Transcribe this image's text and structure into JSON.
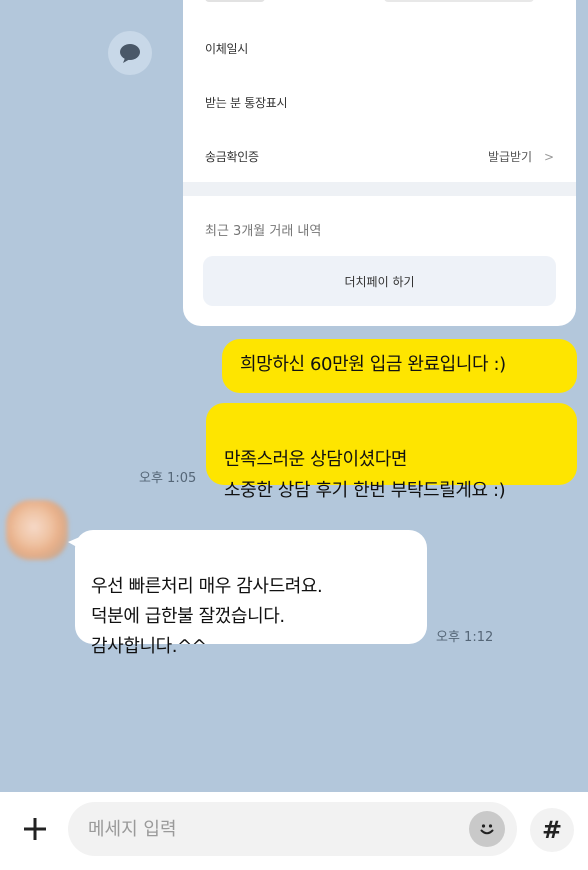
{
  "receipt": {
    "rows": [
      {
        "label": "이체일시"
      },
      {
        "label": "받는 분 통장표시"
      },
      {
        "label": "송금확인증",
        "action": "발급받기"
      }
    ],
    "history_label": "최근 3개월 거래 내역",
    "pay_button": "더치페이 하기"
  },
  "messages": {
    "out": [
      {
        "text": "희망하신 60만원 입금 완료입니다 :)"
      },
      {
        "text": "만족스러운 상담이셨다면\n소중한 상담 후기 한번 부탁드릴게요 :)"
      }
    ],
    "out_time": "오후 1:05",
    "in": {
      "text": "우선 빠른처리 매우 감사드려요.\n덕분에 급한불 잘껐습니다.\n감사합니다.^^"
    },
    "in_time": "오후 1:12"
  },
  "composer": {
    "placeholder": "메세지 입력",
    "plus_icon": "plus-icon",
    "emoji_icon": "emoji-icon",
    "hash_label": "#"
  },
  "colors": {
    "background": "#b3c7db",
    "my_bubble": "#fee500",
    "their_bubble": "#ffffff"
  }
}
